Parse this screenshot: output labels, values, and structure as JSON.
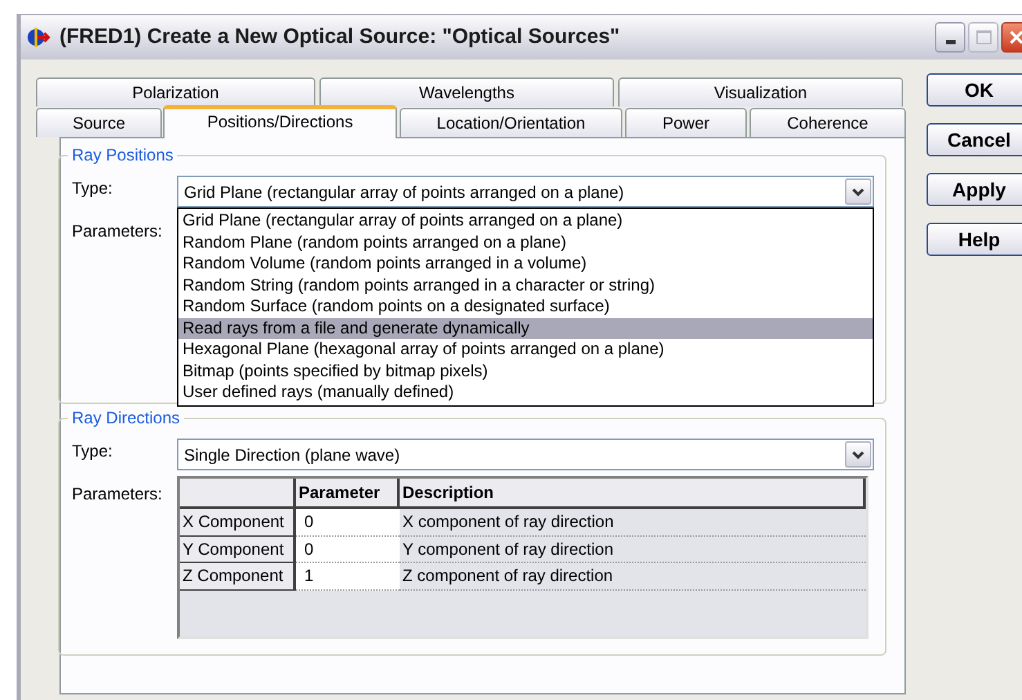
{
  "window": {
    "title": "(FRED1) Create a New Optical Source: \"Optical Sources\""
  },
  "tab_rows": [
    [
      {
        "label": "Polarization",
        "selected": false
      },
      {
        "label": "Wavelengths",
        "selected": false
      },
      {
        "label": "Visualization",
        "selected": false
      }
    ],
    [
      {
        "label": "Source",
        "selected": false
      },
      {
        "label": "Positions/Directions",
        "selected": true
      },
      {
        "label": "Location/Orientation",
        "selected": false
      },
      {
        "label": "Power",
        "selected": false
      },
      {
        "label": "Coherence",
        "selected": false
      }
    ]
  ],
  "buttons": [
    "OK",
    "Cancel",
    "Apply",
    "Help"
  ],
  "ray_positions": {
    "legend": "Ray Positions",
    "type_label": "Type:",
    "type_value": "Grid Plane (rectangular array of points arranged on a plane)",
    "parameters_label": "Parameters:",
    "options": [
      {
        "label": "Grid Plane (rectangular array of points arranged on a plane)",
        "selected": false
      },
      {
        "label": "Random Plane (random points arranged on a plane)",
        "selected": false
      },
      {
        "label": "Random Volume (random points arranged in a volume)",
        "selected": false
      },
      {
        "label": "Random String (random points arranged in a character or string)",
        "selected": false
      },
      {
        "label": "Random Surface (random points on a designated surface)",
        "selected": false
      },
      {
        "label": "Read rays from a file and generate dynamically",
        "selected": true
      },
      {
        "label": "Hexagonal Plane (hexagonal array of points arranged on a plane)",
        "selected": false
      },
      {
        "label": "Bitmap (points specified by bitmap pixels)",
        "selected": false
      },
      {
        "label": "User defined rays (manually defined)",
        "selected": false
      }
    ]
  },
  "ray_directions": {
    "legend": "Ray Directions",
    "type_label": "Type:",
    "type_value": "Single Direction (plane wave)",
    "parameters_label": "Parameters:",
    "table": {
      "columns": [
        "Parameter",
        "Description"
      ],
      "rows": [
        {
          "name": "X Component",
          "parameter": "0",
          "description": "X component of ray direction"
        },
        {
          "name": "Y Component",
          "parameter": "0",
          "description": "Y component of ray direction"
        },
        {
          "name": "Z Component",
          "parameter": "1",
          "description": "Z component of ray direction"
        }
      ]
    }
  }
}
